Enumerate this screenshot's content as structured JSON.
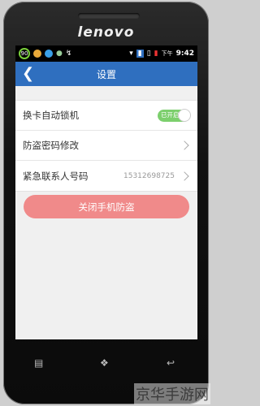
{
  "device": {
    "brand": "lenovo"
  },
  "statusbar": {
    "battery_circle": "90",
    "time_prefix": "下午",
    "time": "9:42"
  },
  "header": {
    "title": "设置"
  },
  "settings": {
    "items": [
      {
        "label": "换卡自动锁机",
        "toggle_text": "已开启"
      },
      {
        "label": "防盗密码修改"
      },
      {
        "label": "紧急联系人号码",
        "value": "15312698725"
      }
    ]
  },
  "actions": {
    "close_button": "关闭手机防盗"
  },
  "watermark": "京华手游网",
  "colors": {
    "titlebar": "#2f6fbf",
    "button": "#f08a8a",
    "toggle": "#7ccf6d"
  }
}
